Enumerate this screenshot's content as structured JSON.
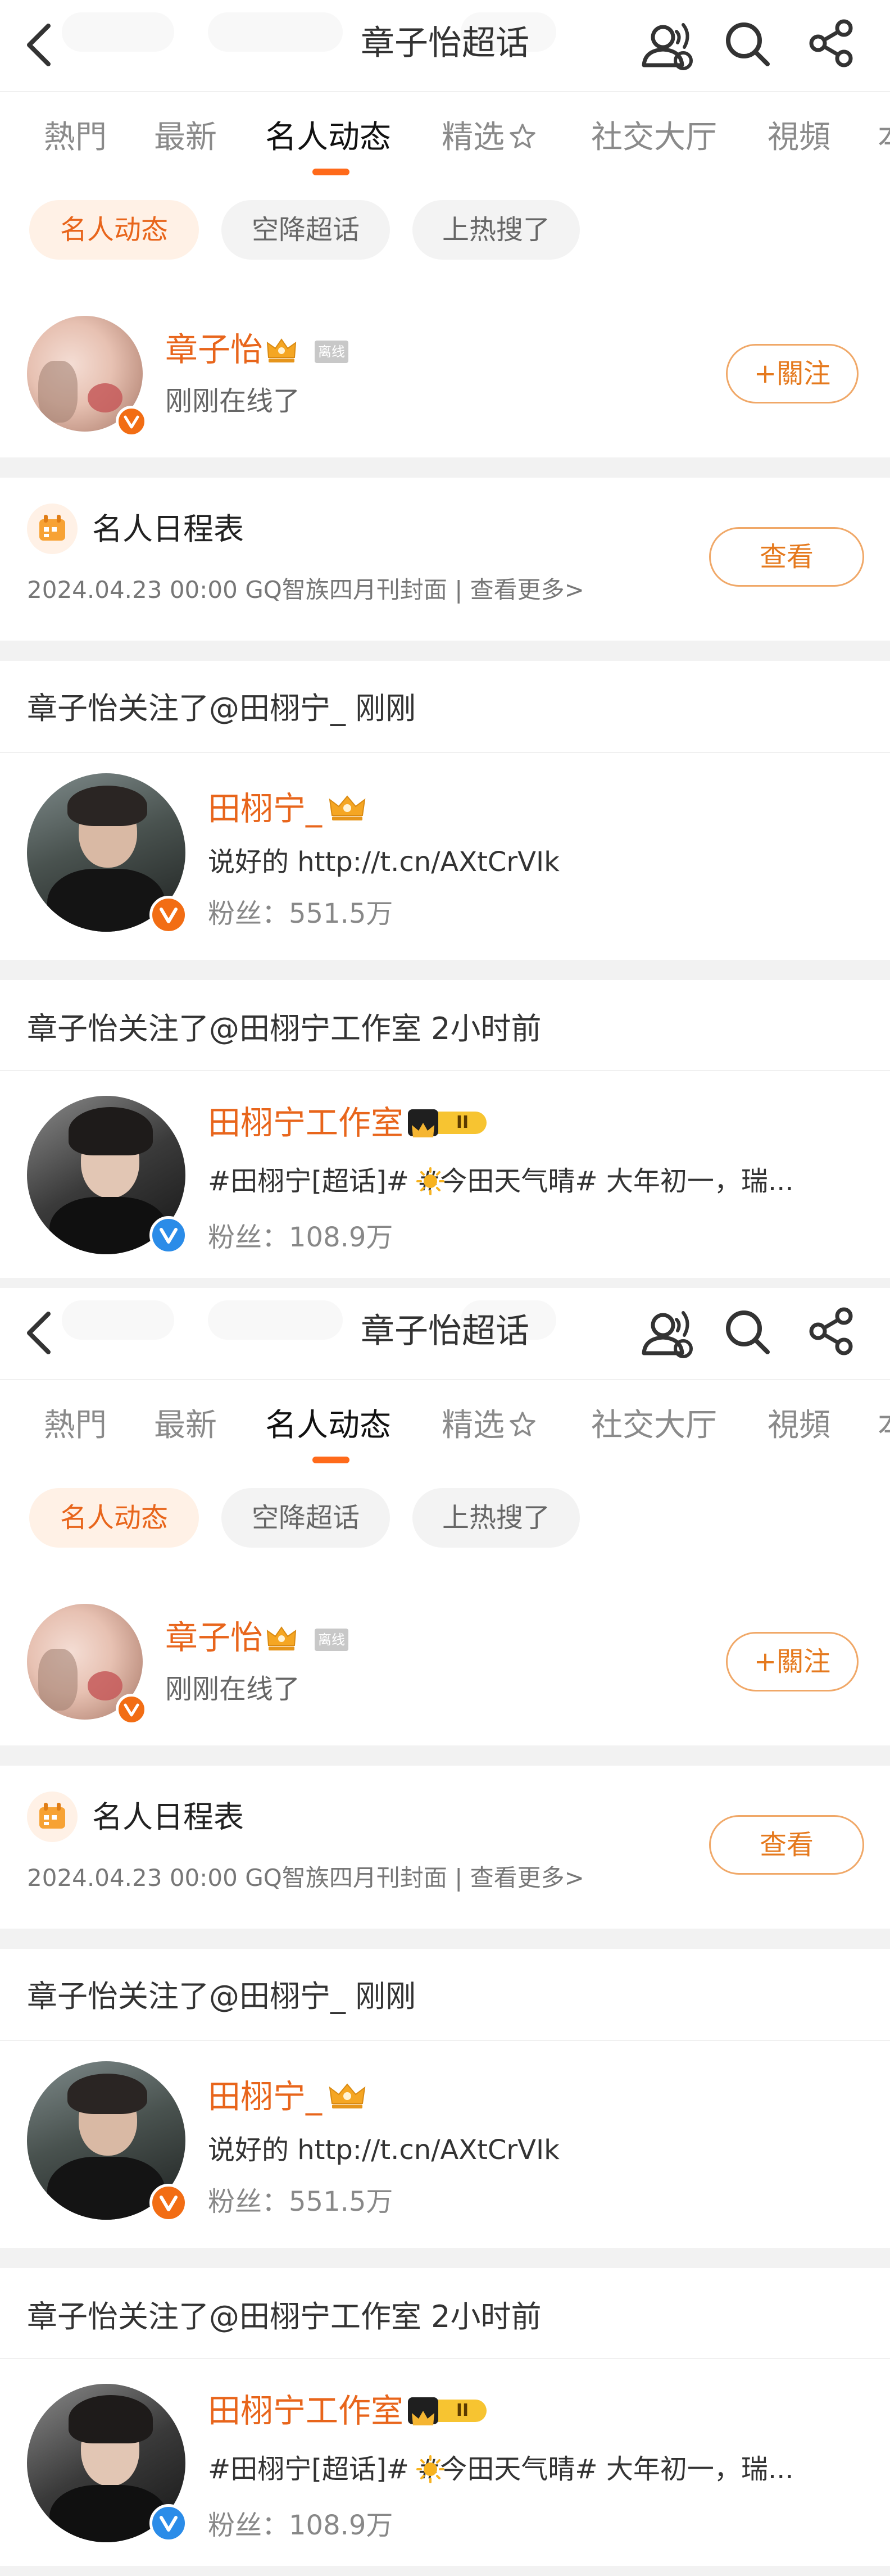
{
  "header": {
    "title": "章子怡超话"
  },
  "tabs": [
    {
      "label": "熱門"
    },
    {
      "label": "最新"
    },
    {
      "label": "名人动态"
    },
    {
      "label": "精选"
    },
    {
      "label": "社交大厅"
    },
    {
      "label": "視頻"
    }
  ],
  "chips": [
    "名人动态",
    "空降超话",
    "上热搜了"
  ],
  "celebrity": {
    "name": "章子怡",
    "status_badge": "离线",
    "status": "刚刚在线了",
    "follow_label": "+關注"
  },
  "schedule": {
    "title": "名人日程表",
    "detail": "2024.04.23 00:00 GQ智族四月刊封面 |  查看更多>",
    "button": "查看"
  },
  "follow_events": [
    {
      "text": "章子怡关注了@田栩宁_ 刚刚",
      "name": "田栩宁_",
      "desc": "说好的 http://t.cn/AXtCrVIk",
      "fans": "粉丝：551.5万"
    },
    {
      "text": "章子怡关注了@田栩宁工作室 2小时前",
      "name": "田栩宁工作室",
      "level": "II",
      "desc": "#田栩宁[超话]#  #今田天气晴# 大年初一，瑞...",
      "fans": "粉丝：108.9万"
    }
  ],
  "colors": {
    "accent": "#ff6a1a",
    "orange_text": "#e8651b",
    "chip_bg": "#fff1e6",
    "verified_orange": "#f26d14",
    "verified_blue": "#2b8ce8"
  },
  "icons": [
    "back-arrow-icon",
    "members-icon",
    "search-icon",
    "share-icon",
    "crown-icon",
    "calendar-icon",
    "verified-icon",
    "sun-icon"
  ]
}
